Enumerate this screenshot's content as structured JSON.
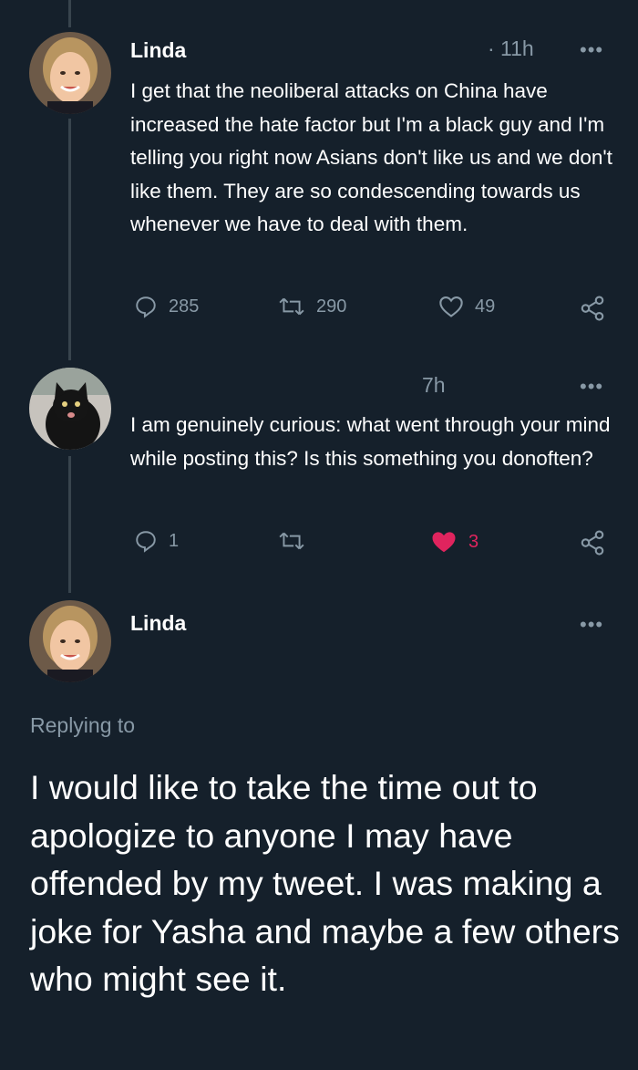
{
  "tweets": [
    {
      "author": "Linda",
      "time": "· 11h",
      "more": "•••",
      "text": "I get that the neoliberal attacks on China have increased the hate factor but I'm a black guy and I'm telling you right now Asians don't like us and we don't like them. They are so condescending towards us whenever we have to deal with them.",
      "replies": "285",
      "retweets": "290",
      "likes": "49",
      "liked": false
    },
    {
      "author": "",
      "time": "7h",
      "more": "•••",
      "text": "I am genuinely curious: what went through your mind while posting this? Is this something you donoften?",
      "replies": "1",
      "retweets": "",
      "likes": "3",
      "liked": true
    },
    {
      "author": "Linda",
      "more": "•••",
      "replying_to": "Replying to",
      "text": "I would like to take the time out to apologize to anyone I may have offended by my tweet. I was making a joke for Yasha and maybe a few others who might see it."
    }
  ],
  "colors": {
    "background": "#15202b",
    "secondary_text": "#8899a6",
    "thread_line": "#38444d",
    "like_red": "#e0245e"
  },
  "icons": [
    "reply-icon",
    "retweet-icon",
    "like-icon",
    "share-icon",
    "more-icon"
  ]
}
